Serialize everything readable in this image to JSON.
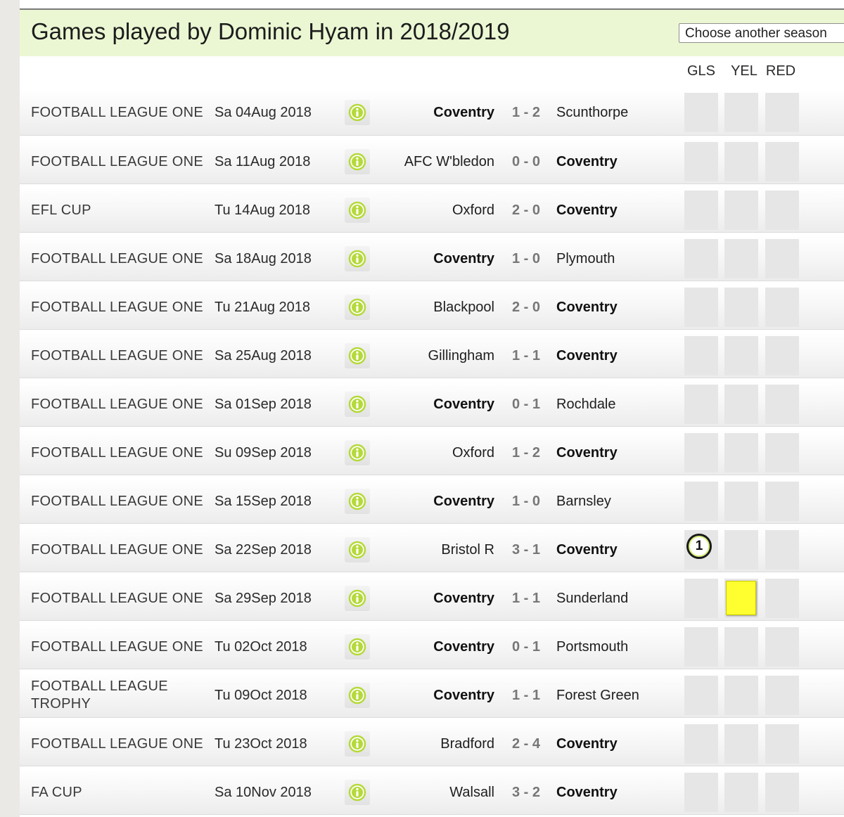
{
  "page": {
    "title": "Games played by Dominic Hyam in 2018/2019",
    "season_select_label": "Choose another season"
  },
  "columns": {
    "gls": "GLS",
    "yel": "YEL",
    "red": "RED"
  },
  "colors": {
    "title_bg": "#ebf7d3",
    "info_icon": "#b5d93a",
    "yellow_card": "#ffff30"
  },
  "games": [
    {
      "competition": "FOOTBALL LEAGUE ONE",
      "date": "Sa 04Aug 2018",
      "home": "Coventry",
      "score": "1 - 2",
      "away": "Scunthorpe",
      "coventry": "home",
      "goals": "",
      "yellow": false,
      "red": false
    },
    {
      "competition": "FOOTBALL LEAGUE ONE",
      "date": "Sa 11Aug 2018",
      "home": "AFC W'bledon",
      "score": "0 - 0",
      "away": "Coventry",
      "coventry": "away",
      "goals": "",
      "yellow": false,
      "red": false
    },
    {
      "competition": "EFL CUP",
      "date": "Tu 14Aug 2018",
      "home": "Oxford",
      "score": "2 - 0",
      "away": "Coventry",
      "coventry": "away",
      "goals": "",
      "yellow": false,
      "red": false
    },
    {
      "competition": "FOOTBALL LEAGUE ONE",
      "date": "Sa 18Aug 2018",
      "home": "Coventry",
      "score": "1 - 0",
      "away": "Plymouth",
      "coventry": "home",
      "goals": "",
      "yellow": false,
      "red": false
    },
    {
      "competition": "FOOTBALL LEAGUE ONE",
      "date": "Tu 21Aug 2018",
      "home": "Blackpool",
      "score": "2 - 0",
      "away": "Coventry",
      "coventry": "away",
      "goals": "",
      "yellow": false,
      "red": false
    },
    {
      "competition": "FOOTBALL LEAGUE ONE",
      "date": "Sa 25Aug 2018",
      "home": "Gillingham",
      "score": "1 - 1",
      "away": "Coventry",
      "coventry": "away",
      "goals": "",
      "yellow": false,
      "red": false
    },
    {
      "competition": "FOOTBALL LEAGUE ONE",
      "date": "Sa 01Sep 2018",
      "home": "Coventry",
      "score": "0 - 1",
      "away": "Rochdale",
      "coventry": "home",
      "goals": "",
      "yellow": false,
      "red": false
    },
    {
      "competition": "FOOTBALL LEAGUE ONE",
      "date": "Su 09Sep 2018",
      "home": "Oxford",
      "score": "1 - 2",
      "away": "Coventry",
      "coventry": "away",
      "goals": "",
      "yellow": false,
      "red": false
    },
    {
      "competition": "FOOTBALL LEAGUE ONE",
      "date": "Sa 15Sep 2018",
      "home": "Coventry",
      "score": "1 - 0",
      "away": "Barnsley",
      "coventry": "home",
      "goals": "",
      "yellow": false,
      "red": false
    },
    {
      "competition": "FOOTBALL LEAGUE ONE",
      "date": "Sa 22Sep 2018",
      "home": "Bristol R",
      "score": "3 - 1",
      "away": "Coventry",
      "coventry": "away",
      "goals": "1",
      "yellow": false,
      "red": false
    },
    {
      "competition": "FOOTBALL LEAGUE ONE",
      "date": "Sa 29Sep 2018",
      "home": "Coventry",
      "score": "1 - 1",
      "away": "Sunderland",
      "coventry": "home",
      "goals": "",
      "yellow": true,
      "red": false
    },
    {
      "competition": "FOOTBALL LEAGUE ONE",
      "date": "Tu 02Oct 2018",
      "home": "Coventry",
      "score": "0 - 1",
      "away": "Portsmouth",
      "coventry": "home",
      "goals": "",
      "yellow": false,
      "red": false
    },
    {
      "competition": "FOOTBALL LEAGUE TROPHY",
      "date": "Tu 09Oct 2018",
      "home": "Coventry",
      "score": "1 - 1",
      "away": "Forest Green",
      "coventry": "home",
      "goals": "",
      "yellow": false,
      "red": false
    },
    {
      "competition": "FOOTBALL LEAGUE ONE",
      "date": "Tu 23Oct 2018",
      "home": "Bradford",
      "score": "2 - 4",
      "away": "Coventry",
      "coventry": "away",
      "goals": "",
      "yellow": false,
      "red": false
    },
    {
      "competition": "FA CUP",
      "date": "Sa 10Nov 2018",
      "home": "Walsall",
      "score": "3 - 2",
      "away": "Coventry",
      "coventry": "away",
      "goals": "",
      "yellow": false,
      "red": false
    }
  ]
}
